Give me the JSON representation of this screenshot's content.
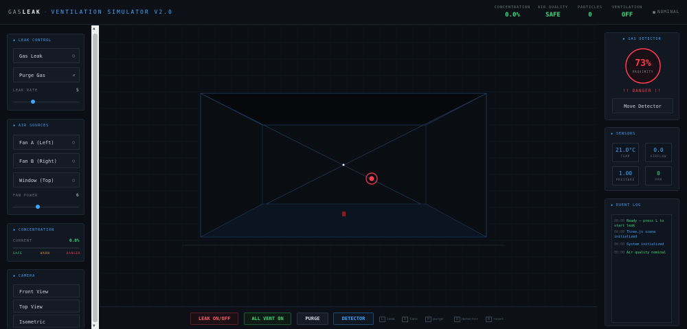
{
  "header": {
    "brand_part1": "GAS",
    "brand_part2": "LEAK",
    "separator": "·",
    "subtitle": "VENTILATION SIMULATOR V2.0",
    "stats": [
      {
        "label": "CONCENTRATION",
        "value": "0.0%"
      },
      {
        "label": "AIR QUALITY",
        "value": "SAFE"
      },
      {
        "label": "PARTICLES",
        "value": "0"
      },
      {
        "label": "VENTILATION",
        "value": "OFF"
      }
    ],
    "status": "NOMINAL"
  },
  "leak_control": {
    "title": "LEAK CONTROL",
    "gas_leak_label": "Gas Leak",
    "purge_gas_label": "Purge Gas",
    "leak_rate_label": "LEAK RATE",
    "leak_rate_value": "5",
    "leak_rate_fraction": 0.3
  },
  "air_sources": {
    "title": "AIR SOURCES",
    "items": [
      {
        "label": "Fan A (Left)"
      },
      {
        "label": "Fan B (Right)"
      },
      {
        "label": "Window (Top)"
      }
    ],
    "fan_power_label": "FAN POWER",
    "fan_power_value": "6",
    "fan_power_fraction": 0.37
  },
  "concentration": {
    "title": "CONCENTRATION",
    "current_label": "CURRENT",
    "current_value": "0.0%",
    "scale": [
      "SAFE",
      "WARN",
      "DANGER"
    ]
  },
  "camera": {
    "title": "CAMERA",
    "views": [
      "Front View",
      "Top View",
      "Isometric"
    ]
  },
  "toolbar": {
    "leak_label": "LEAK ON/OFF",
    "vent_label": "ALL VENT ON",
    "purge_label": "PURGE",
    "detector_label": "DETECTOR",
    "hints": [
      {
        "key": "L",
        "label": "leak"
      },
      {
        "key": "V",
        "label": "fans"
      },
      {
        "key": "P",
        "label": "purge"
      },
      {
        "key": "D",
        "label": "detector"
      },
      {
        "key": "R",
        "label": "reset"
      }
    ]
  },
  "gas_detector": {
    "title": "GAS DETECTOR",
    "percent": "73%",
    "sub": "PROXIMITY",
    "warning": "!! DANGER !!",
    "move_label": "Move Detector"
  },
  "sensors": {
    "title": "SENSORS",
    "items": [
      {
        "value": "21.0°C",
        "label": "TEMP"
      },
      {
        "value": "0.0",
        "label": "AIRFLOW"
      },
      {
        "value": "1.00",
        "label": "PRESSURE"
      },
      {
        "value": "0",
        "label": "PPM"
      }
    ]
  },
  "event_log": {
    "title": "EVENT LOG",
    "entries": [
      {
        "time": "00:00",
        "text": "Ready — press L to start leak",
        "color": "#3fd97b"
      },
      {
        "time": "00:00",
        "text": "Three.js scene initialized",
        "color": "#3fa7ff"
      },
      {
        "time": "00:00",
        "text": "System initialized",
        "color": "#3fa7ff"
      },
      {
        "time": "00:00",
        "text": "Air quality nominal",
        "color": "#3fd97b"
      }
    ]
  },
  "colors": {
    "accent": "#3fa7ff",
    "safe": "#3fd97b",
    "danger": "#ff3b4e",
    "warn": "#f0a030"
  }
}
